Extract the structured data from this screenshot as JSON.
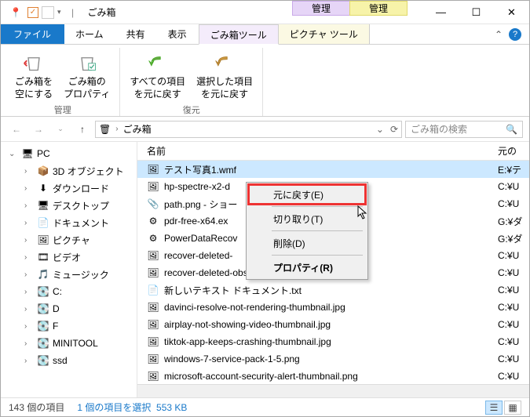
{
  "title": "ごみ箱",
  "contextual_tabs": {
    "purple": "管理",
    "yellow": "管理"
  },
  "window_controls": {
    "minimize": "—",
    "maximize": "☐",
    "close": "✕"
  },
  "tabs": {
    "file": "ファイル",
    "home": "ホーム",
    "share": "共有",
    "view": "表示",
    "tool_purple": "ごみ箱ツール",
    "tool_yellow": "ピクチャ ツール"
  },
  "ribbon": {
    "group_manage": {
      "label": "管理",
      "empty": "ごみ箱を\n空にする",
      "properties": "ごみ箱の\nプロパティ"
    },
    "group_restore": {
      "label": "復元",
      "restore_all": "すべての項目\nを元に戻す",
      "restore_selected": "選択した項目\nを元に戻す"
    }
  },
  "address": {
    "location": "ごみ箱",
    "refresh": "⟳",
    "dropdown": "⌄"
  },
  "search": {
    "placeholder": "ごみ箱の検索"
  },
  "nav": {
    "pc": "PC",
    "items": [
      {
        "label": "3D オブジェクト",
        "icon": "📦"
      },
      {
        "label": "ダウンロード",
        "icon": "⬇"
      },
      {
        "label": "デスクトップ",
        "icon": "🖥"
      },
      {
        "label": "ドキュメント",
        "icon": "📄"
      },
      {
        "label": "ピクチャ",
        "icon": "🖼"
      },
      {
        "label": "ビデオ",
        "icon": "🎞"
      },
      {
        "label": "ミュージック",
        "icon": "🎵"
      },
      {
        "label": "C:",
        "icon": "💽"
      },
      {
        "label": "D",
        "icon": "💽"
      },
      {
        "label": "F",
        "icon": "💽"
      },
      {
        "label": "MINITOOL",
        "icon": "💽"
      },
      {
        "label": "ssd",
        "icon": "💽"
      }
    ]
  },
  "columns": {
    "name": "名前",
    "original_location": "元の"
  },
  "files": [
    {
      "name": "テスト写真1.wmf",
      "loc": "E:¥テ",
      "icon": "🖼",
      "selected": true
    },
    {
      "name": "hp-spectre-x2-d",
      "loc": "C:¥U",
      "icon": "🖼"
    },
    {
      "name": "path.png - ショー",
      "loc": "C:¥U",
      "icon": "📎"
    },
    {
      "name": "pdr-free-x64.ex",
      "loc": "G:¥ダ",
      "icon": "⚙"
    },
    {
      "name": "PowerDataRecov",
      "loc": "G:¥ダ",
      "icon": "⚙"
    },
    {
      "name": "recover-deleted-",
      "loc": "C:¥U",
      "icon": "🖼"
    },
    {
      "name": "recover-deleted-obs-recordings-9.png",
      "loc": "C:¥U",
      "icon": "🖼"
    },
    {
      "name": "新しいテキスト ドキュメント.txt",
      "loc": "C:¥U",
      "icon": "📄"
    },
    {
      "name": "davinci-resolve-not-rendering-thumbnail.jpg",
      "loc": "C:¥U",
      "icon": "🖼"
    },
    {
      "name": "airplay-not-showing-video-thumbnail.jpg",
      "loc": "C:¥U",
      "icon": "🖼"
    },
    {
      "name": "tiktok-app-keeps-crashing-thumbnail.jpg",
      "loc": "C:¥U",
      "icon": "🖼"
    },
    {
      "name": "windows-7-service-pack-1-5.png",
      "loc": "C:¥U",
      "icon": "🖼"
    },
    {
      "name": "microsoft-account-security-alert-thumbnail.png",
      "loc": "C:¥U",
      "icon": "🖼"
    }
  ],
  "context_menu": {
    "restore": "元に戻す(E)",
    "cut": "切り取り(T)",
    "delete": "削除(D)",
    "properties": "プロパティ(R)"
  },
  "status": {
    "count": "143 個の項目",
    "selected": "1 個の項目を選択",
    "size": "553 KB"
  }
}
